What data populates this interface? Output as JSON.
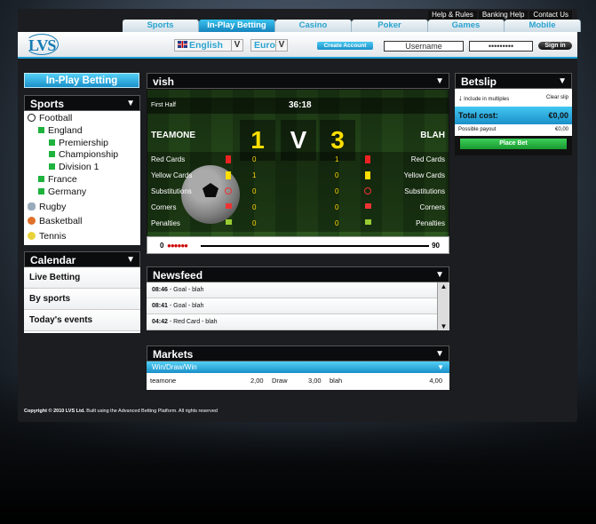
{
  "top_links": [
    "Help & Rules",
    "Banking Help",
    "Contact Us"
  ],
  "tabs": [
    "Sports",
    "In-Play Betting",
    "Casino",
    "Poker",
    "Games",
    "Mobile"
  ],
  "header": {
    "logo": "LVS",
    "language": "English",
    "currency": "Euro",
    "create_account": "Create Account",
    "username": "Username",
    "password": "•••••••••",
    "sign_in": "Sign in",
    "dropdown": "V"
  },
  "left": {
    "inplay_button": "In-Play Betting",
    "sports_title": "Sports",
    "sports": [
      "Football",
      "England",
      "Premiership",
      "Championship",
      "Division 1",
      "France",
      "Germany",
      "Rugby",
      "Basketball",
      "Tennis"
    ],
    "calendar_title": "Calendar",
    "calendar": [
      "Live Betting",
      "By sports",
      "Today's events"
    ]
  },
  "match": {
    "title": "vish",
    "half": "First Half",
    "time": "36:18",
    "team_a": "TEAMONE",
    "team_b": "BLAH",
    "score_a": "1",
    "score_b": "3",
    "v": "V",
    "stats": [
      {
        "label": "Red Cards",
        "a": "0",
        "b": "1"
      },
      {
        "label": "Yellow Cards",
        "a": "1",
        "b": "0"
      },
      {
        "label": "Substitutions",
        "a": "0",
        "b": "0"
      },
      {
        "label": "Corners",
        "a": "0",
        "b": "0"
      },
      {
        "label": "Penalties",
        "a": "0",
        "b": "0"
      }
    ],
    "timeline_start": "0",
    "timeline_end": "90"
  },
  "newsfeed": {
    "title": "Newsfeed",
    "items": [
      {
        "time": "08:46",
        "text": " - Goal - blah"
      },
      {
        "time": "08:41",
        "text": " - Goal - blah"
      },
      {
        "time": "04:42",
        "text": " - Red Card - blah"
      }
    ]
  },
  "markets": {
    "title": "Markets",
    "market": "Win/Draw/Win",
    "row": [
      "teamone",
      "2,00",
      "Draw",
      "3,00",
      "blah",
      "4,00"
    ]
  },
  "betslip": {
    "title": "Betslip",
    "include": "Include in multiples",
    "clear": "Clear slip",
    "total_label": "Total cost:",
    "total": "€0,00",
    "payout_label": "Possible payout",
    "payout": "€0,00",
    "place_bet": "Place Bet"
  },
  "footer": {
    "bold": "Copyright © 2010 LVS Ltd.",
    "text": " Built using the Advanced Betting Platform. All rights reserved"
  },
  "colors": {
    "accent": "#1b9bd2",
    "green": "#1db33d",
    "score": "#ffe000"
  }
}
